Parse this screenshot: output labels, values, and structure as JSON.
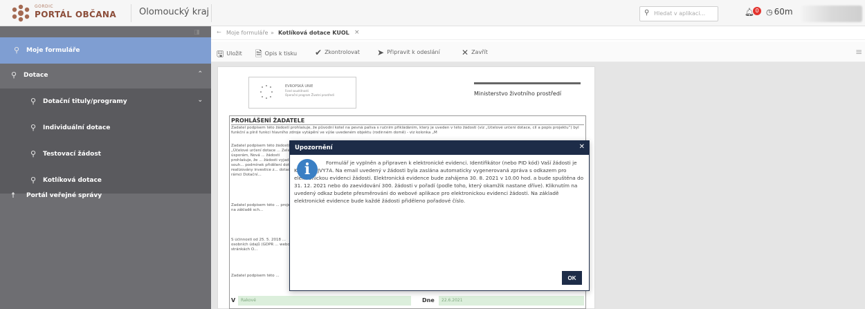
{
  "header": {
    "logo_small": "GORDIC",
    "logo_title": "PORTÁL OBČANA",
    "region": "Olomoucký kraj",
    "search_placeholder": "Hledat v aplikaci...",
    "notification_count": "0",
    "session_timer": "60m",
    "user_partial": "..."
  },
  "breadcrumb": {
    "back": "←",
    "items": [
      "Moje formuláře",
      "Kotlíková dotace KUOL"
    ],
    "separator": "»",
    "close": "×"
  },
  "sidebar": {
    "items": [
      {
        "label": "Moje formuláře",
        "state": "active"
      },
      {
        "label": "Dotace",
        "state": "expanded"
      },
      {
        "label": "Dotační tituly/programy",
        "state": "sub"
      },
      {
        "label": "Individuální dotace",
        "state": "sub"
      },
      {
        "label": "Testovací žádost",
        "state": "sub"
      },
      {
        "label": "Kotlíková dotace",
        "state": "sub"
      },
      {
        "label": "Portál veřejné správy",
        "state": "normal"
      }
    ]
  },
  "toolbar": {
    "save": "Uložit",
    "print": "Opis k tisku",
    "check": "Zkontrolovat",
    "prepare": "Připravit k odeslání",
    "close": "Zavřít"
  },
  "document": {
    "eu_line1": "EVROPSKÁ UNIE",
    "eu_line2": "Fond soudržnosti",
    "eu_line3": "Operační program Životní prostředí",
    "ministry": "Ministerstvo životního prostředí",
    "section_title": "PROHLÁŠENÍ ŽADATELE",
    "para1": "Žadatel podpisem této žádosti prohlašuje, že původní kotel na pevná paliva s ručním přikládáním, který je uveden v této žádosti (viz „Účelové určení dotace, cíl a popis projektu“) byl funkční a plnil funkci hlavního zdroje vytápění ve výše uvedeném objektu (rodinném domě) - viz kolonka „M",
    "para2": "Žadatel podpisem této žádosti ... „Účelové určení dotace ... Zelená úsporám, Nová ... žádosti prohlašuje, že ... žádosti vyjadřuje souh... podmínek přidělení dot... realizovány investice z... dotace v rámci Dotační...",
    "para3": "Žadatel podpisem této ... projektu na základě sch...",
    "para4": "S účinností od 25. 5. 2018 ... osobních údajů (GDPR ... webových stránkách O...",
    "para5": "Žadatel podpisem této ...",
    "sign_v": "V",
    "sign_place": "Rakové",
    "sign_date_label": "Dne",
    "sign_date": "22.6.2021"
  },
  "dialog": {
    "title": "Upozornění",
    "message": "Formulář je vyplněn a připraven k elektronické evidenci. Identifikátor (nebo PID kód) Vaší žádosti je KUOLX01JVY7A. Na email uvedený v žádosti byla zaslána automaticky vygenerovaná zpráva s odkazem pro elektronickou evidenci žádosti. Elektronická evidence bude zahájena 30. 8. 2021 v 10.00 hod. a bude spuštěna do 31. 12. 2021 nebo do zaevidování 300. žádosti v pořadí (podle toho, který okamžik nastane dříve). Kliknutím na uvedený odkaz budete přesměrováni do webové aplikace pro elektronickou evidenci žádosti. Na základě elektronické evidence bude každé žádosti přiděleno pořadové číslo.",
    "ok": "OK"
  },
  "colors": {
    "sidebar_bg": "#6e6e72",
    "sidebar_active": "#7f9ed2",
    "dialog_header": "#1d2c48",
    "brand": "#8c4d39"
  }
}
